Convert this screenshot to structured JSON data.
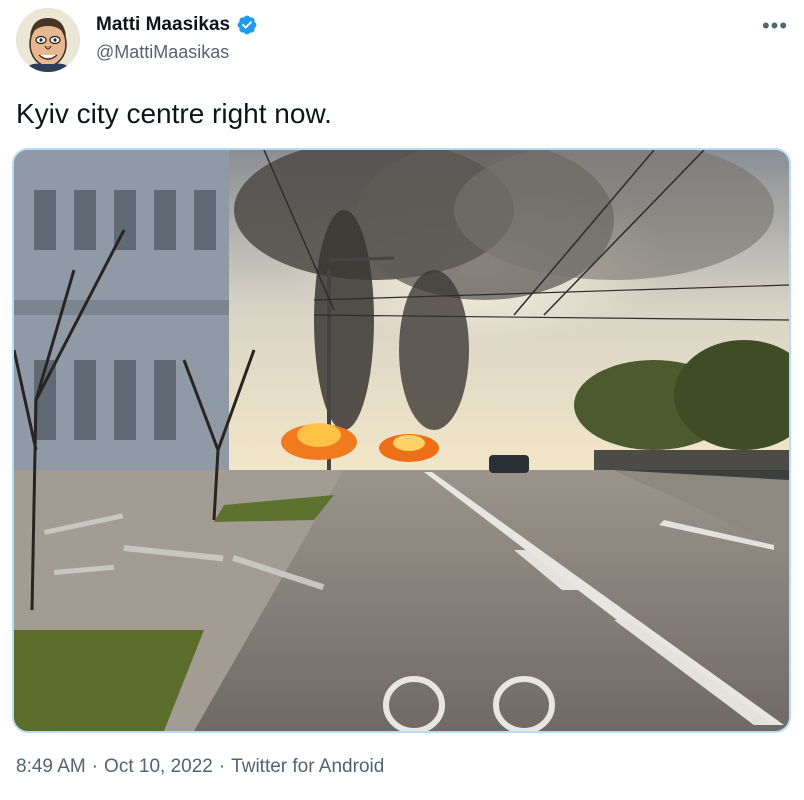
{
  "author": {
    "display_name": "Matti Maasikas",
    "handle": "@MattiMaasikas",
    "verified": true,
    "avatar_icon": "caricature-avatar"
  },
  "tweet": {
    "text": "Kyiv city centre right now.",
    "image_description_icon": "photo-street-explosion"
  },
  "meta": {
    "time": "8:49 AM",
    "separator": "·",
    "date": "Oct 10, 2022",
    "source": "Twitter for Android"
  },
  "colors": {
    "verified_blue": "#1d9bf0",
    "secondary_text": "#536471",
    "primary_text": "#0f1419",
    "media_border": "#b9dcf6"
  }
}
